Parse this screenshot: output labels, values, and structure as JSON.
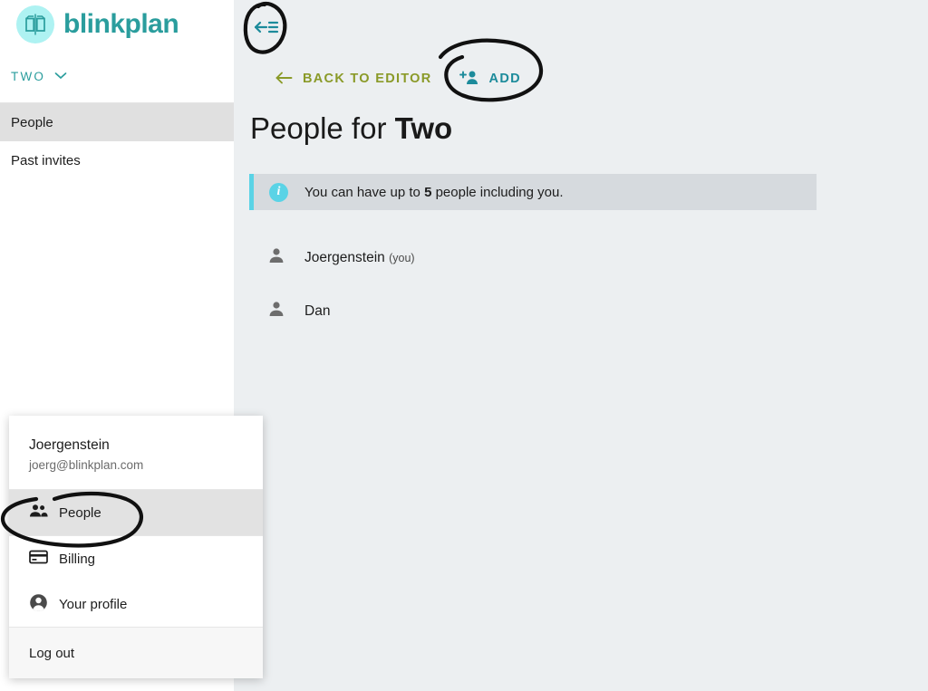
{
  "brand": {
    "name": "blinkplan",
    "logo_icon": "open-book-icon",
    "logo_bg": "#aef2f2",
    "logo_stroke": "#2a9d9d",
    "text_color": "#2a9d9d"
  },
  "sidebar": {
    "workspace": {
      "label": "TWO",
      "chevron_icon": "chevron-down-icon",
      "color": "#2a9d9d"
    },
    "items": [
      {
        "label": "People",
        "active": true
      },
      {
        "label": "Past invites",
        "active": false
      }
    ]
  },
  "toolbar": {
    "collapse_icon": "menu-collapse-left-icon",
    "back_label": "BACK TO EDITOR",
    "back_icon": "arrow-left-icon",
    "back_color": "#8a9a28",
    "add_label": "ADD",
    "add_icon": "person-add-icon",
    "add_color": "#1c8b9b"
  },
  "main": {
    "title_prefix": "People for ",
    "title_accent": "Two",
    "banner": {
      "icon": "info-icon",
      "text_before": "You can have up to ",
      "count": "5",
      "text_after": " people including you.",
      "accent_color": "#5ad3e6",
      "background": "#d6dade"
    },
    "people": [
      {
        "icon": "person-icon",
        "name": "Joergenstein",
        "suffix": "(you)"
      },
      {
        "icon": "person-icon",
        "name": "Dan",
        "suffix": ""
      }
    ]
  },
  "account_menu": {
    "name": "Joergenstein",
    "email": "joerg@blinkplan.com",
    "items": [
      {
        "label": "People",
        "icon": "people-group-icon",
        "highlight": true
      },
      {
        "label": "Billing",
        "icon": "credit-card-icon",
        "highlight": false
      },
      {
        "label": "Your profile",
        "icon": "account-circle-icon",
        "highlight": false
      }
    ],
    "logout_label": "Log out"
  },
  "annotations": {
    "color": "#111111",
    "marks": [
      {
        "name": "circle-around-collapse-icon"
      },
      {
        "name": "circle-around-add-button"
      },
      {
        "name": "circle-around-people-menu-item"
      }
    ]
  },
  "colors": {
    "page_bg": "#eceff1",
    "sidebar_bg": "#ffffff",
    "nav_active": "#e0e0e0"
  }
}
